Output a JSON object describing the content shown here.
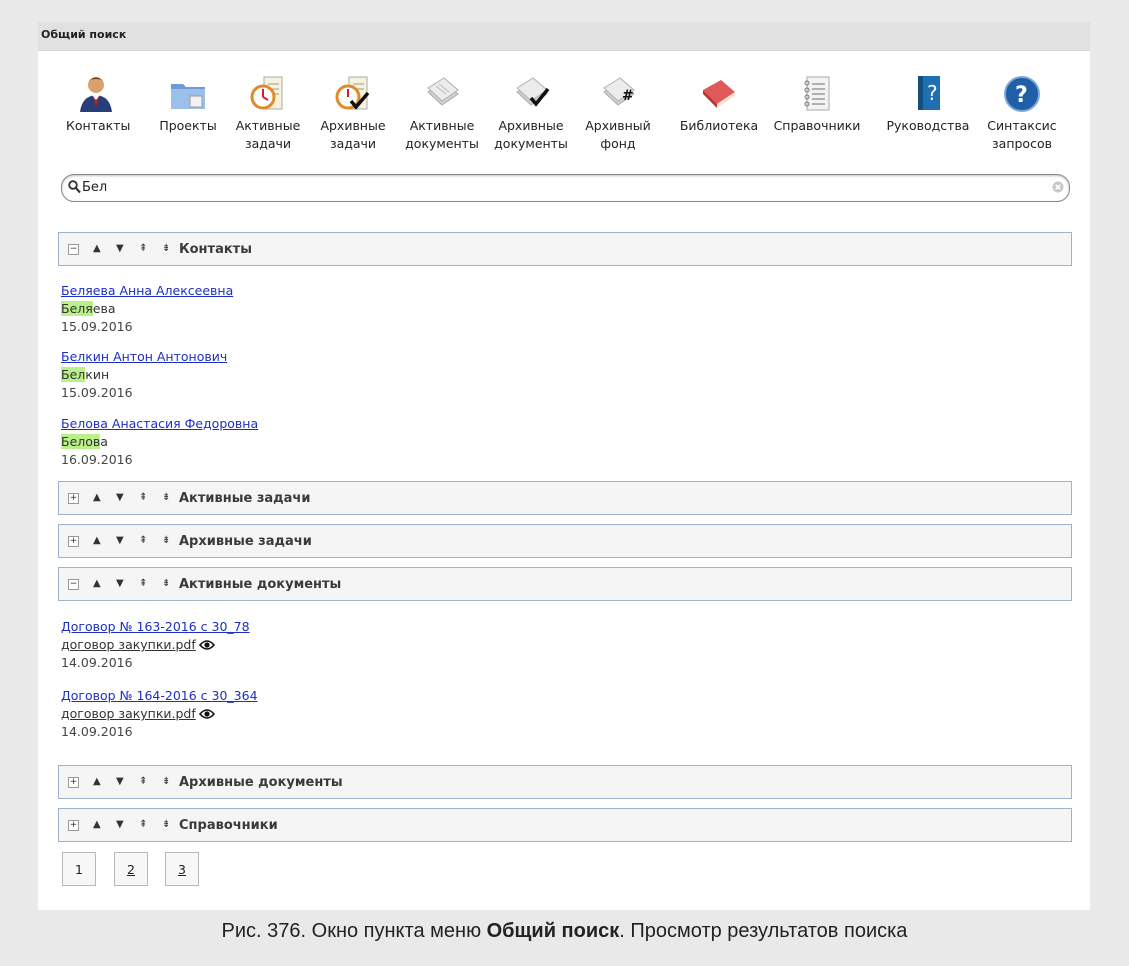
{
  "window": {
    "title": "Общий поиск"
  },
  "toolbar": {
    "items": [
      {
        "name": "contacts",
        "label": "Контакты",
        "icon": "person-icon"
      },
      {
        "name": "projects",
        "label": "Проекты",
        "icon": "folder-icon"
      },
      {
        "name": "active-tasks",
        "label": "Активные\nзадачи",
        "icon": "clock-task-icon"
      },
      {
        "name": "archive-tasks",
        "label": "Архивные\nзадачи",
        "icon": "clock-check-icon"
      },
      {
        "name": "active-docs",
        "label": "Активные\nдокументы",
        "icon": "documents-icon"
      },
      {
        "name": "archive-docs",
        "label": "Архивные\nдокументы",
        "icon": "documents-check-icon"
      },
      {
        "name": "archive-fund",
        "label": "Архивный\nфонд",
        "icon": "documents-hash-icon"
      },
      {
        "name": "library",
        "label": "Библиотека",
        "icon": "book-icon"
      },
      {
        "name": "directories",
        "label": "Справочники",
        "icon": "notebook-icon"
      },
      {
        "name": "manuals",
        "label": "Руководства",
        "icon": "manual-icon"
      },
      {
        "name": "syntax",
        "label": "Синтаксис\nзапросов",
        "icon": "help-icon"
      }
    ]
  },
  "search": {
    "value": "Бел",
    "placeholder": ""
  },
  "sections": [
    {
      "title": "Контакты",
      "toggle": "−",
      "expanded": true
    },
    {
      "title": "Активные задачи",
      "toggle": "+",
      "expanded": false
    },
    {
      "title": "Архивные задачи",
      "toggle": "+",
      "expanded": false
    },
    {
      "title": "Активные документы",
      "toggle": "−",
      "expanded": true
    },
    {
      "title": "Архивные документы",
      "toggle": "+",
      "expanded": false
    },
    {
      "title": "Справочники",
      "toggle": "+",
      "expanded": false
    }
  ],
  "section_controls": {
    "up": "▲",
    "down": "▼",
    "top": "⇞",
    "bottom": "⇟"
  },
  "contacts": [
    {
      "name": "Беляева Анна Алексеевна",
      "match": "Беля",
      "rest": "ева",
      "date": "15.09.2016"
    },
    {
      "name": "Белкин Антон Антонович",
      "match": "Бел",
      "rest": "кин",
      "date": "15.09.2016"
    },
    {
      "name": "Белова Анастасия Федоровна",
      "match": "Белов",
      "rest": "а",
      "date": "16.09.2016"
    }
  ],
  "documents": [
    {
      "title": "Договор № 163-2016 с 30_78",
      "file": "договор закупки.pdf",
      "date": "14.09.2016"
    },
    {
      "title": "Договор № 164-2016 с 30_364",
      "file": "договор закупки.pdf",
      "date": "14.09.2016"
    }
  ],
  "pager": {
    "pages": [
      "1",
      "2",
      "3"
    ],
    "current": "1"
  },
  "caption": {
    "prefix": "Рис. 376. Окно пункта меню ",
    "bold": "Общий поиск",
    "suffix": ". Просмотр результатов поиска"
  },
  "colors": {
    "link": "#1d2fc4",
    "highlight": "#b9f08a",
    "section_border": "#9eb3c9"
  }
}
